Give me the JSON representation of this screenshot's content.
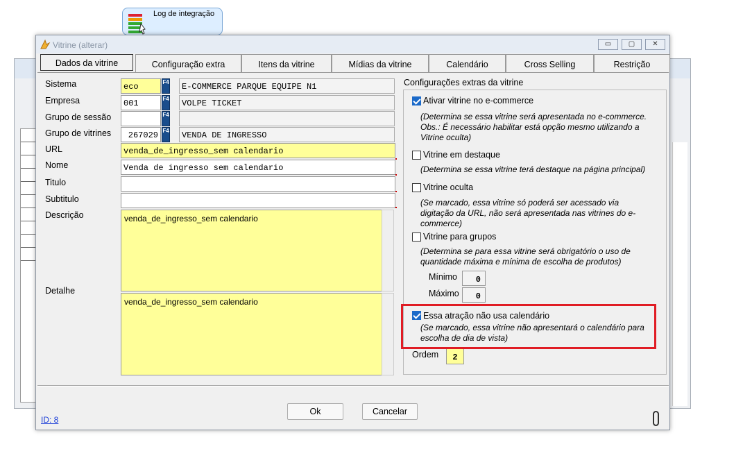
{
  "shortcut": {
    "label": "Log de integração"
  },
  "window": {
    "title": "Vitrine (alterar)",
    "controls": {
      "minimize": "▭",
      "restore": "▢",
      "close": "✕"
    }
  },
  "tabs": [
    {
      "label": "Dados da vitrine",
      "active": true
    },
    {
      "label": "Configuração extra"
    },
    {
      "label": "Itens da vitrine"
    },
    {
      "label": "Mídias da vitrine"
    },
    {
      "label": "Calendário"
    },
    {
      "label": "Cross Selling"
    },
    {
      "label": "Restrição"
    }
  ],
  "form": {
    "sistema": {
      "label": "Sistema",
      "code": "eco",
      "desc": "E-COMMERCE PARQUE EQUIPE N1"
    },
    "empresa": {
      "label": "Empresa",
      "code": "001",
      "desc": "VOLPE TICKET"
    },
    "grupo_sessao": {
      "label": "Grupo de sessão",
      "code": "",
      "desc": ""
    },
    "grupo_vitrines": {
      "label": "Grupo de vitrines",
      "code": "267029",
      "desc": "VENDA DE INGRESSO"
    },
    "url": {
      "label": "URL",
      "value": "venda_de_ingresso_sem calendario"
    },
    "nome": {
      "label": "Nome",
      "value": "Venda de ingresso sem calendario"
    },
    "titulo": {
      "label": "Titulo",
      "value": ""
    },
    "subtitulo": {
      "label": "Subtitulo",
      "value": ""
    },
    "descricao": {
      "label": "Descrição",
      "value": "venda_de_ingresso_sem calendario"
    },
    "detalhe": {
      "label": "Detalhe",
      "value": "venda_de_ingresso_sem calendario"
    },
    "f4": "F4"
  },
  "extras": {
    "title": "Configurações extras da vitrine",
    "ativar": {
      "label": "Ativar vitrine no e-commerce",
      "checked": true,
      "note": "(Determina se essa vitrine será apresentada no e-commerce. Obs.: É necessário habilitar está opção mesmo utilizando a Vitrine oculta)"
    },
    "destaque": {
      "label": "Vitrine em destaque",
      "checked": false,
      "note": "(Determina se essa vitrine terá destaque na página principal)"
    },
    "oculta": {
      "label": "Vitrine oculta",
      "checked": false,
      "note": "(Se marcado, essa vitrine só poderá ser acessado via digitação da URL, não será apresentada nas vitrines do e-commerce)"
    },
    "grupos": {
      "label": "Vitrine para grupos",
      "checked": false,
      "note": "(Determina se para essa vitrine será obrigatório o uso de quantidade máxima e mínima de escolha de produtos)"
    },
    "minimo": {
      "label": "Mínimo",
      "value": "0"
    },
    "maximo": {
      "label": "Máximo",
      "value": "0"
    },
    "sem_calendario": {
      "label": "Essa atração não usa calendário",
      "checked": true,
      "note": "(Se marcado, essa vitrine não apresentará o calendário para escolha de dia de vista)"
    },
    "ordem": {
      "label": "Ordem",
      "value": "2"
    }
  },
  "footer": {
    "ok": "Ok",
    "cancel": "Cancelar",
    "id_link": "ID: 8"
  },
  "colors": {
    "highlight": "#e01c24",
    "field_yellow": "#ffff99",
    "check_blue": "#1b6ac9"
  }
}
